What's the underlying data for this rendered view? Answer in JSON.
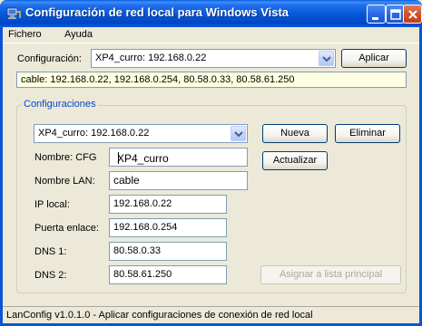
{
  "window": {
    "title": "Configuración de red local para Windows Vista"
  },
  "menu": {
    "items": [
      {
        "label": "Fichero"
      },
      {
        "label": "Ayuda"
      }
    ]
  },
  "top": {
    "config_label": "Configuración:",
    "config_selected": "XP4_curro: 192.168.0.22",
    "apply_label": "Aplicar",
    "info_text": "cable: 192.168.0.22, 192.168.0.254, 80.58.0.33, 80.58.61.250"
  },
  "group": {
    "title": "Configuraciones",
    "selected": "XP4_curro: 192.168.0.22",
    "new_label": "Nueva",
    "delete_label": "Eliminar",
    "update_label": "Actualizar",
    "assign_label": "Asignar a lista principal"
  },
  "fields": {
    "cfg_name": {
      "label": "Nombre: CFG",
      "value": "XP4_curro"
    },
    "lan_name": {
      "label": "Nombre LAN:",
      "value": "cable"
    },
    "local_ip": {
      "label": "IP local:",
      "value": "192.168.0.22"
    },
    "gateway": {
      "label": "Puerta enlace:",
      "value": "192.168.0.254"
    },
    "dns1": {
      "label": "DNS 1:",
      "value": "80.58.0.33"
    },
    "dns2": {
      "label": "DNS 2:",
      "value": "80.58.61.250"
    }
  },
  "status": {
    "text": "LanConfig v1.0.1.0 - Aplicar configuraciones de conexión de red local"
  },
  "colors": {
    "titlebar": "#0A5ADE",
    "window_bg": "#ECE9D8",
    "group_title": "#0046D5",
    "info_bg": "#FFFFE1"
  },
  "icons": {
    "app": "network-computer-icon",
    "minimize": "minimize-icon",
    "maximize": "maximize-icon",
    "close": "close-icon",
    "dropdown": "chevron-down-icon"
  }
}
